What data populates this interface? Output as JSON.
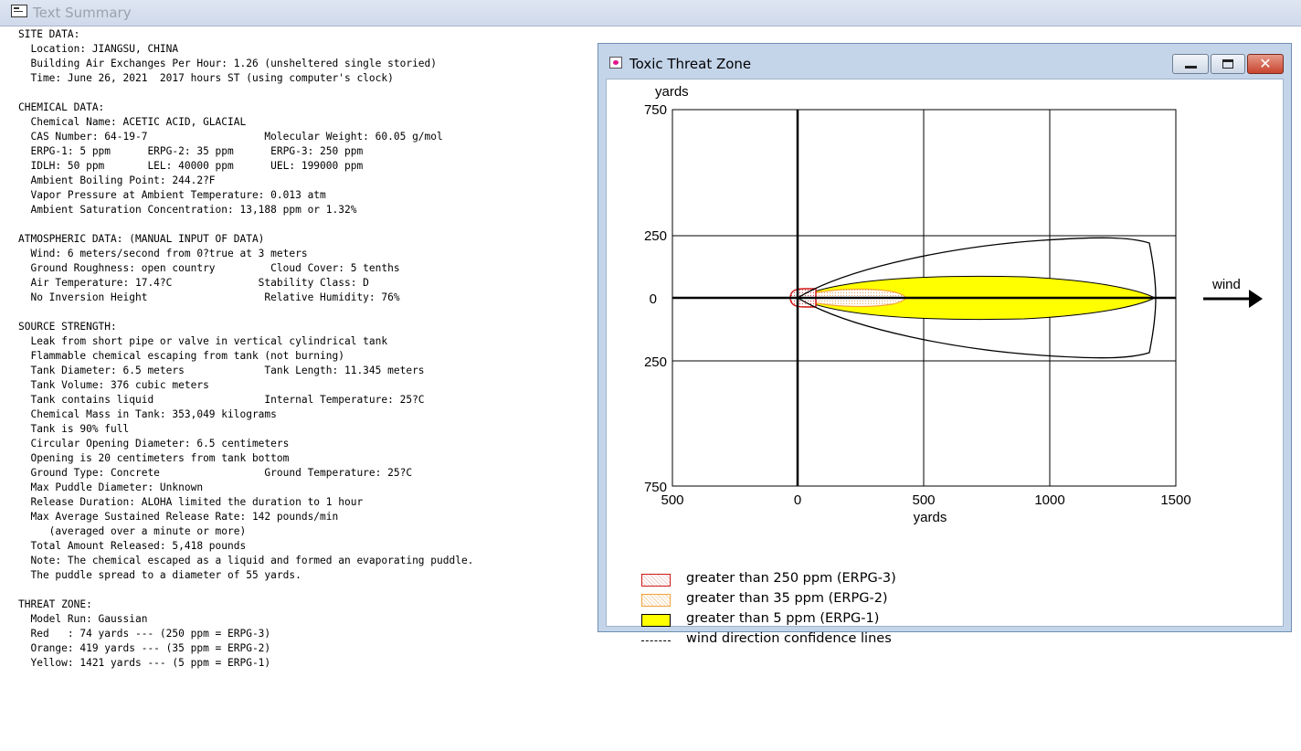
{
  "window": {
    "title": "Text Summary"
  },
  "summary_lines": [
    "SITE DATA:",
    "  Location: JIANGSU, CHINA",
    "  Building Air Exchanges Per Hour: 1.26 (unsheltered single storied)",
    "  Time: June 26, 2021  2017 hours ST (using computer's clock)",
    "",
    "CHEMICAL DATA:",
    "  Chemical Name: ACETIC ACID, GLACIAL",
    "  CAS Number: 64-19-7                   Molecular Weight: 60.05 g/mol",
    "  ERPG-1: 5 ppm      ERPG-2: 35 ppm      ERPG-3: 250 ppm",
    "  IDLH: 50 ppm       LEL: 40000 ppm      UEL: 199000 ppm",
    "  Ambient Boiling Point: 244.2?F",
    "  Vapor Pressure at Ambient Temperature: 0.013 atm",
    "  Ambient Saturation Concentration: 13,188 ppm or 1.32%",
    "",
    "ATMOSPHERIC DATA: (MANUAL INPUT OF DATA)",
    "  Wind: 6 meters/second from 0?true at 3 meters",
    "  Ground Roughness: open country         Cloud Cover: 5 tenths",
    "  Air Temperature: 17.4?C              Stability Class: D",
    "  No Inversion Height                   Relative Humidity: 76%",
    "",
    "SOURCE STRENGTH:",
    "  Leak from short pipe or valve in vertical cylindrical tank",
    "  Flammable chemical escaping from tank (not burning)",
    "  Tank Diameter: 6.5 meters             Tank Length: 11.345 meters",
    "  Tank Volume: 376 cubic meters",
    "  Tank contains liquid                  Internal Temperature: 25?C",
    "  Chemical Mass in Tank: 353,049 kilograms",
    "  Tank is 90% full",
    "  Circular Opening Diameter: 6.5 centimeters",
    "  Opening is 20 centimeters from tank bottom",
    "  Ground Type: Concrete                 Ground Temperature: 25?C",
    "  Max Puddle Diameter: Unknown",
    "  Release Duration: ALOHA limited the duration to 1 hour",
    "  Max Average Sustained Release Rate: 142 pounds/min",
    "     (averaged over a minute or more)",
    "  Total Amount Released: 5,418 pounds",
    "  Note: The chemical escaped as a liquid and formed an evaporating puddle.",
    "  The puddle spread to a diameter of 55 yards.",
    "",
    "THREAT ZONE:",
    "  Model Run: Gaussian",
    "  Red   : 74 yards --- (250 ppm = ERPG-3)",
    "  Orange: 419 yards --- (35 ppm = ERPG-2)",
    "  Yellow: 1421 yards --- (5 ppm = ERPG-1)"
  ],
  "threat_window": {
    "title": "Toxic Threat Zone",
    "x_label": "yards",
    "y_label": "yards",
    "wind_label": "wind",
    "x_ticks": [
      "500",
      "0",
      "500",
      "1000",
      "1500"
    ],
    "y_ticks": [
      "750",
      "250",
      "0",
      "250",
      "750"
    ],
    "zones": {
      "red_yards": 74,
      "orange_yards": 419,
      "yellow_yards": 1421
    },
    "colors": {
      "red": "#d01818",
      "orange": "#f2a33a",
      "yellow": "#ffff00"
    },
    "legend": [
      {
        "label": "greater than 250 ppm (ERPG-3)",
        "swatch": "red-dotted"
      },
      {
        "label": "greater than 35 ppm (ERPG-2)",
        "swatch": "orange-dotted"
      },
      {
        "label": "greater than 5 ppm (ERPG-1)",
        "swatch": "yellow-solid"
      },
      {
        "label": "wind direction confidence lines",
        "swatch": "dashed-line"
      }
    ],
    "buttons": {
      "minimize": "minimize-icon",
      "maximize": "maximize-icon",
      "close": "close-icon"
    }
  }
}
